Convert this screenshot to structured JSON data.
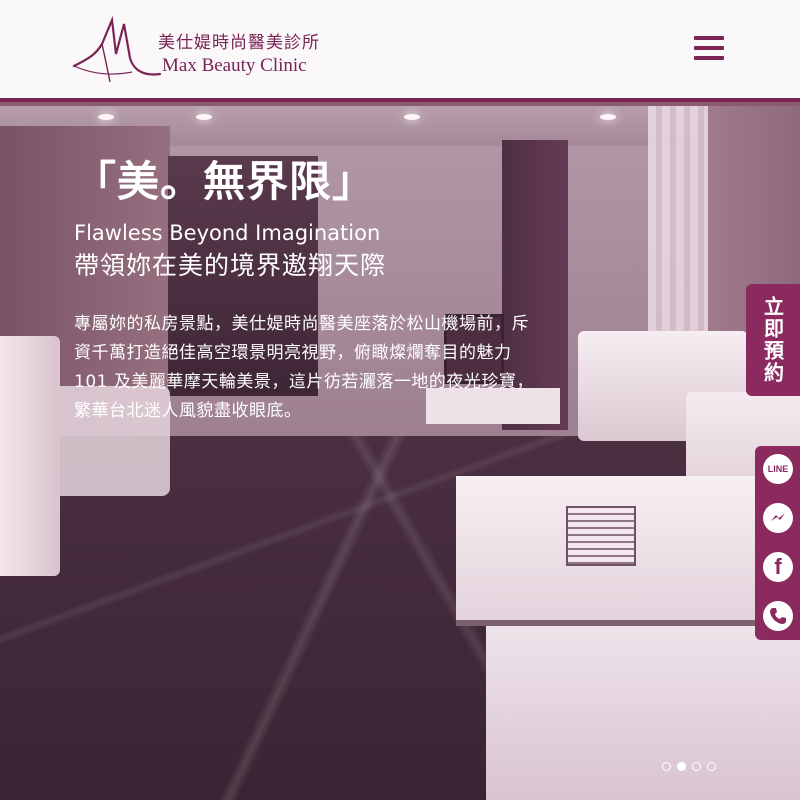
{
  "header": {
    "brand_zh": "美仕媞時尚醫美診所",
    "brand_en": "Max Beauty Clinic",
    "logo_icon": "max-logo-icon",
    "menu_icon": "hamburger-menu-icon"
  },
  "hero": {
    "headline": "「美。無界限」",
    "subtitle_en": "Flawless Beyond Imagination",
    "subtitle_zh": "帶領妳在美的境界遨翔天際",
    "description": "專屬妳的私房景點，美仕媞時尚醫美座落於松山機場前，斥資千萬打造絕佳高空環景明亮視野，俯瞰燦爛奪目的魅力 101 及美麗華摩天輪美景，這片彷若灑落一地的夜光珍寶，繁華台北迷人風貌盡收眼底。"
  },
  "side": {
    "booking_label": "立即預約",
    "social": [
      {
        "name": "line-icon",
        "label": "LINE"
      },
      {
        "name": "messenger-icon"
      },
      {
        "name": "facebook-icon",
        "label": "f"
      },
      {
        "name": "phone-icon"
      }
    ]
  },
  "carousel": {
    "slide_count": 4,
    "active_index": 1
  },
  "colors": {
    "brand": "#7a2456",
    "tab": "#8a2a5e",
    "header_bg": "#faf8f9"
  }
}
